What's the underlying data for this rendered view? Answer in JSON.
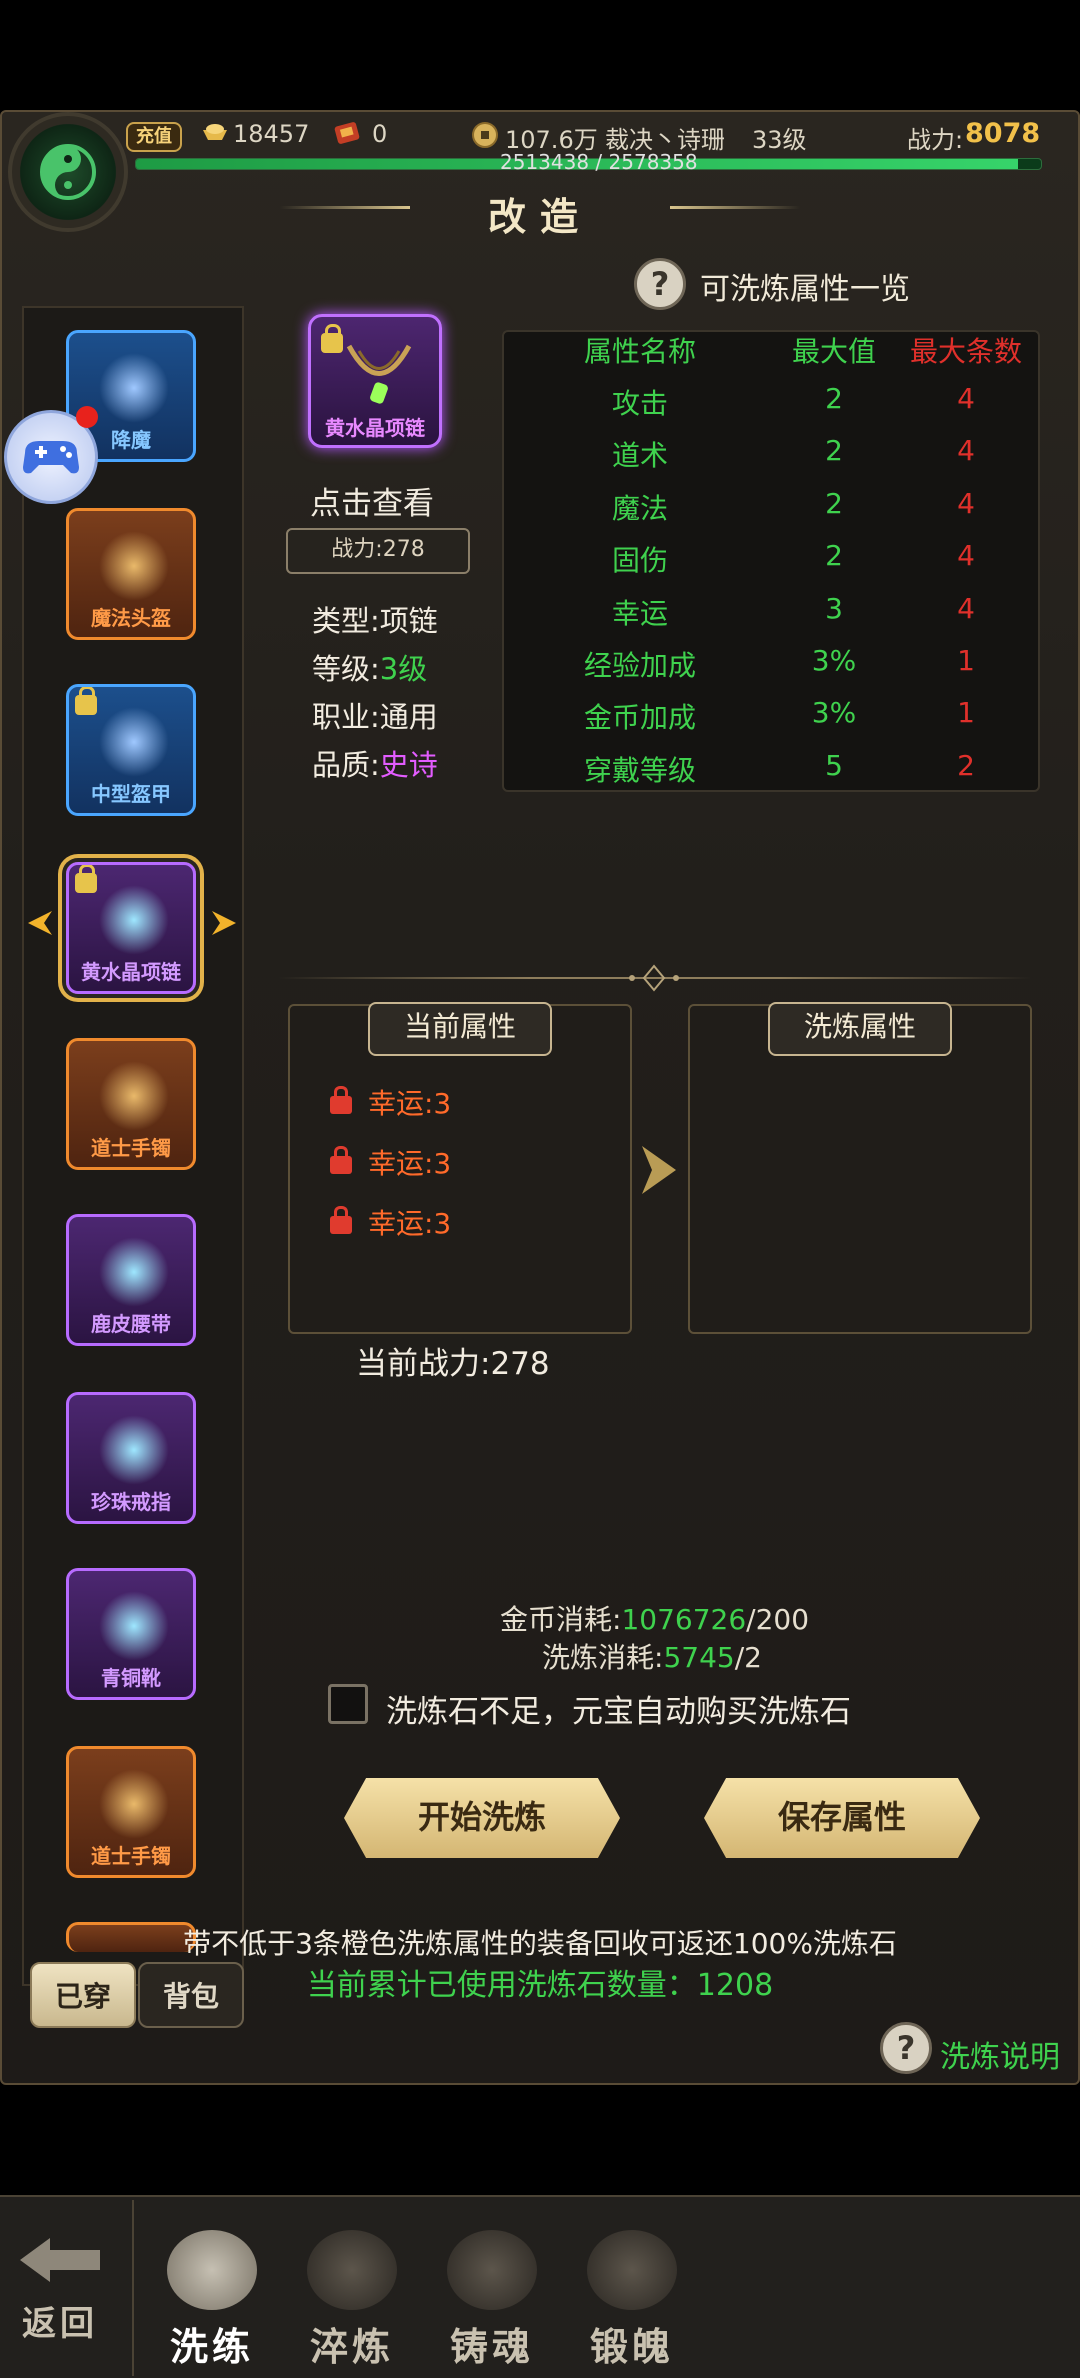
{
  "status": {
    "recharge_label": "充值",
    "gold_ingot": "18457",
    "ticket": "0",
    "coins": "107.6万",
    "player_name": "裁决丶诗珊",
    "level": "33级",
    "power_label": "战力:",
    "power_value": "8078",
    "exp_text": "2513438 / 2578358",
    "exp_ratio": 0.975
  },
  "title": "改造",
  "help_link": "可洗炼属性一览",
  "equipment_slots": [
    {
      "label": "降魔",
      "quality": "blue",
      "locked": false
    },
    {
      "label": "魔法头盔",
      "quality": "orange",
      "locked": false
    },
    {
      "label": "中型盔甲",
      "quality": "blue",
      "locked": true
    },
    {
      "label": "黄水晶项链",
      "quality": "purple",
      "locked": true,
      "selected": true
    },
    {
      "label": "道士手镯",
      "quality": "orange",
      "locked": false
    },
    {
      "label": "鹿皮腰带",
      "quality": "purple",
      "locked": false
    },
    {
      "label": "珍珠戒指",
      "quality": "purple",
      "locked": false
    },
    {
      "label": "青铜靴",
      "quality": "purple",
      "locked": false
    },
    {
      "label": "道士手镯",
      "quality": "orange",
      "locked": false
    }
  ],
  "side_tabs": {
    "worn": "已穿",
    "bag": "背包"
  },
  "item": {
    "name": "黄水晶项链",
    "click_view": "点击查看",
    "power": "战力:278",
    "type": "类型:项链",
    "level_label": "等级:",
    "level_value": "3级",
    "job": "职业:通用",
    "quality_label": "品质:",
    "quality_value": "史诗"
  },
  "attr_table": {
    "headers": [
      "属性名称",
      "最大值",
      "最大条数"
    ],
    "rows": [
      [
        "攻击",
        "2",
        "4"
      ],
      [
        "道术",
        "2",
        "4"
      ],
      [
        "魔法",
        "2",
        "4"
      ],
      [
        "固伤",
        "2",
        "4"
      ],
      [
        "幸运",
        "3",
        "4"
      ],
      [
        "经验加成",
        "3%",
        "1"
      ],
      [
        "金币加成",
        "3%",
        "1"
      ],
      [
        "穿戴等级",
        "5",
        "2"
      ]
    ]
  },
  "current_attrs": {
    "title": "当前属性",
    "items": [
      "幸运:3",
      "幸运:3",
      "幸运:3"
    ]
  },
  "refine_attrs": {
    "title": "洗炼属性"
  },
  "current_power": "当前战力:278",
  "cost": {
    "gold_label": "金币消耗:",
    "gold_have": "1076726",
    "gold_need": "/200",
    "stone_label": "洗炼消耗:",
    "stone_have": "5745",
    "stone_need": "/2"
  },
  "auto_buy": "洗炼石不足，元宝自动购买洗炼石",
  "buttons": {
    "start": "开始洗炼",
    "save": "保存属性"
  },
  "notes": {
    "line1": "带不低于3条橙色洗炼属性的装备回收可返还100%洗炼石",
    "line2": "当前累计已使用洗炼石数量：1208",
    "explain": "洗炼说明"
  },
  "bottom_nav": {
    "back": "返回",
    "tabs": [
      "洗练",
      "淬炼",
      "铸魂",
      "锻魄"
    ]
  },
  "colors": {
    "green": "#3fd24e",
    "red": "#e0302b",
    "purple": "#e35cff",
    "gold": "#f2c14a"
  }
}
